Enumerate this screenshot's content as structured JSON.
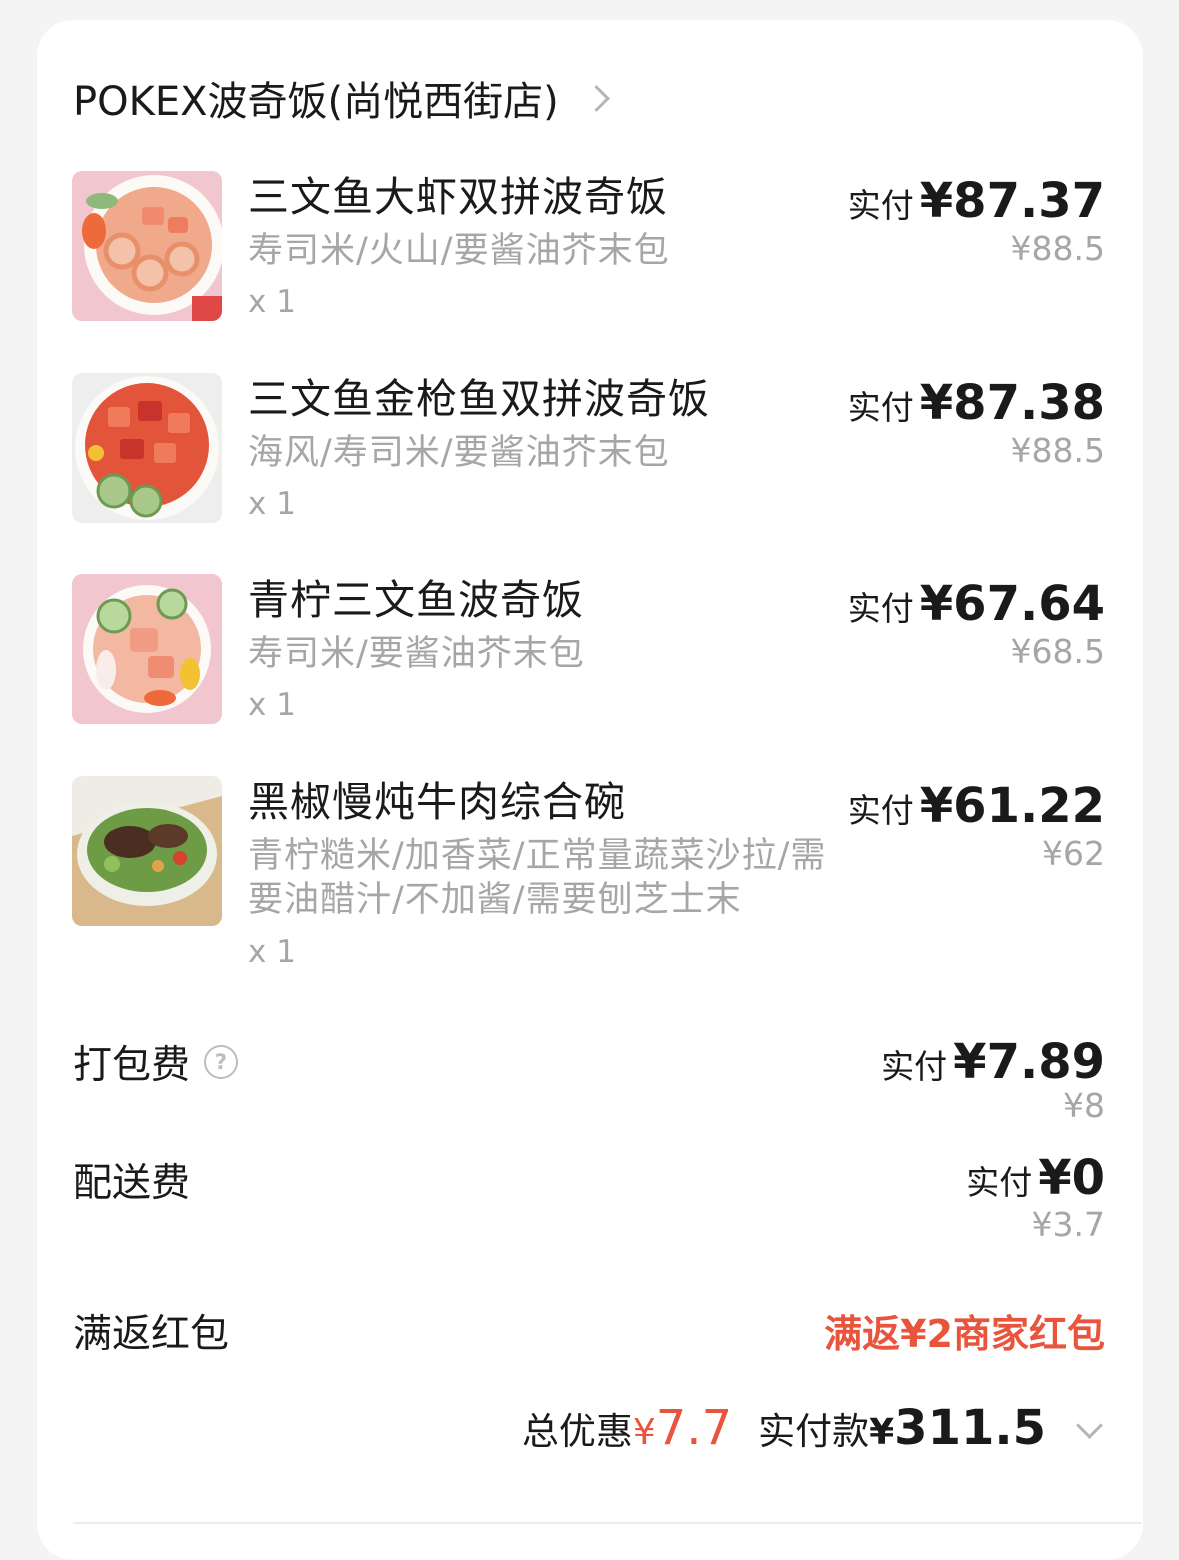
{
  "store": {
    "name": "POKEX波奇饭(尚悦西街店)",
    "chevron_icon": "chevron-right-icon"
  },
  "items": [
    {
      "name": "三文鱼大虾双拼波奇饭",
      "options": "寿司米/火山/要酱油芥末包",
      "qty": "x 1",
      "pay_label": "实付",
      "pay": "¥87.37",
      "original": "¥88.5",
      "thumb_icon": "salmon-shrimp-bowl-image"
    },
    {
      "name": "三文鱼金枪鱼双拼波奇饭",
      "options": "海风/寿司米/要酱油芥末包",
      "qty": "x 1",
      "pay_label": "实付",
      "pay": "¥87.38",
      "original": "¥88.5",
      "thumb_icon": "salmon-tuna-bowl-image"
    },
    {
      "name": "青柠三文鱼波奇饭",
      "options": "寿司米/要酱油芥末包",
      "qty": "x 1",
      "pay_label": "实付",
      "pay": "¥67.64",
      "original": "¥68.5",
      "thumb_icon": "lime-salmon-bowl-image"
    },
    {
      "name": "黑椒慢炖牛肉综合碗",
      "options": "青柠糙米/加香菜/正常量蔬菜沙拉/需要油醋汁/不加酱/需要刨芝士末",
      "qty": "x 1",
      "pay_label": "实付",
      "pay": "¥61.22",
      "original": "¥62",
      "thumb_icon": "beef-salad-bowl-image"
    }
  ],
  "fees": {
    "packing": {
      "label": "打包费",
      "pay_label": "实付",
      "pay": "¥7.89",
      "original": "¥8",
      "help_icon": "question-circle-icon",
      "help_glyph": "?"
    },
    "delivery": {
      "label": "配送费",
      "pay_label": "实付",
      "pay": "¥0",
      "original": "¥3.7"
    }
  },
  "redpacket": {
    "label": "满返红包",
    "value": "满返¥2商家红包"
  },
  "summary": {
    "discount_label": "总优惠",
    "discount_currency": "¥",
    "discount_value": "7.7",
    "paid_label": "实付款",
    "paid_currency": "¥",
    "paid_value": "311.5",
    "expand_icon": "chevron-down-icon"
  },
  "colors": {
    "accent_red": "#e8543c",
    "text": "#1a1a1a",
    "muted": "#a6a6a6",
    "background": "#f4f4f4"
  }
}
